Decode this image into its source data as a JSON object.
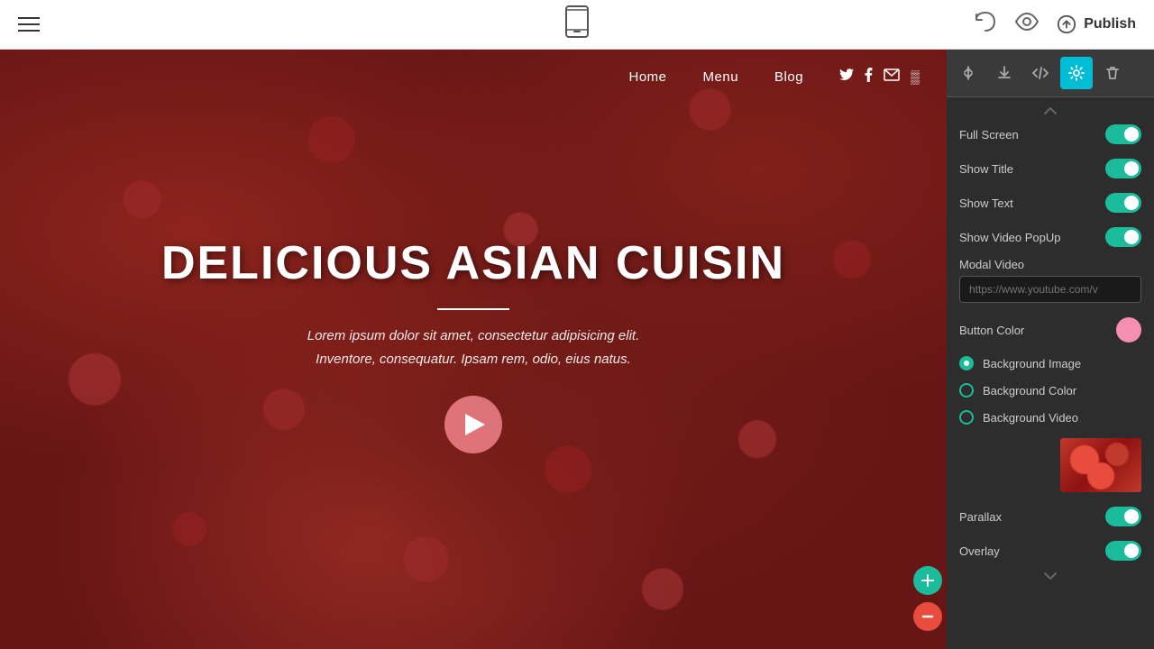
{
  "topbar": {
    "publish_label": "Publish",
    "hamburger_label": "menu",
    "undo_label": "undo",
    "preview_label": "preview"
  },
  "hero": {
    "nav_items": [
      "Home",
      "Menu",
      "Blog"
    ],
    "nav_icons": [
      "twitter",
      "facebook",
      "email",
      "blog"
    ],
    "title": "DELICIOUS ASIAN CUISIN",
    "subtitle_line1": "Lorem ipsum dolor sit amet, consectetur adipisicing elit.",
    "subtitle_line2": "Inventore, consequatur. Ipsam rem, odio, eius natus."
  },
  "panel": {
    "toolbar_buttons": [
      "sort-icon",
      "download-icon",
      "code-icon",
      "settings-icon",
      "trash-icon"
    ],
    "settings": [
      {
        "label": "Full Screen",
        "toggle": true
      },
      {
        "label": "Show Title",
        "toggle": true
      },
      {
        "label": "Show Text",
        "toggle": true
      },
      {
        "label": "Show Video PopUp",
        "toggle": true
      }
    ],
    "modal_video": {
      "label": "Modal Video",
      "placeholder": "https://www.youtube.com/v"
    },
    "button_color": {
      "label": "Button Color",
      "color": "#f48fb1"
    },
    "background_options": [
      {
        "label": "Background Image",
        "selected": true
      },
      {
        "label": "Background Color",
        "selected": false
      },
      {
        "label": "Background Video",
        "selected": false
      }
    ],
    "parallax": {
      "label": "Parallax",
      "toggle": true
    },
    "overlay": {
      "label": "Overlay",
      "toggle": true
    }
  }
}
